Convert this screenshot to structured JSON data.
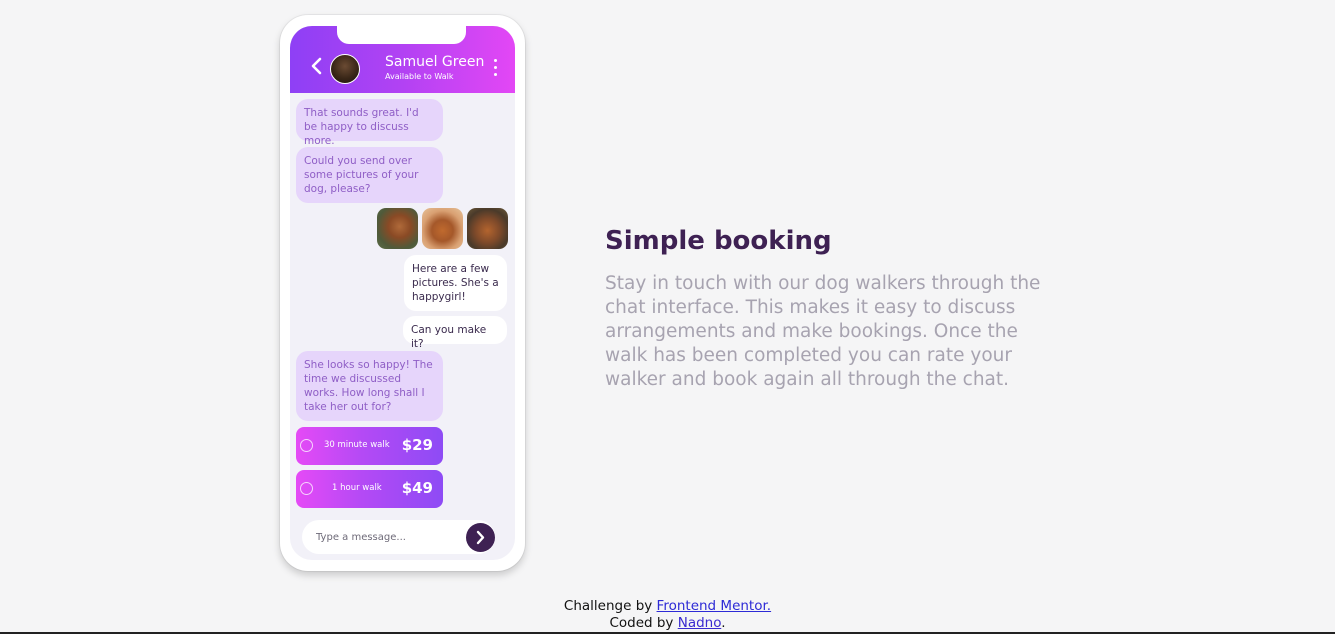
{
  "chat": {
    "contact_name": "Samuel Green",
    "contact_status": "Available to Walk",
    "messages": [
      "That sounds great. I'd be happy to discuss more.",
      "Could you send over some pictures of your dog, please?",
      "Here are a few pictures. She's a happygirl!",
      "Can you make it?",
      "She looks so happy! The time we discussed works. How long shall I take her out for?"
    ],
    "options": [
      {
        "label": "30 minute walk",
        "price": "$29"
      },
      {
        "label": "1 hour walk",
        "price": "$49"
      }
    ],
    "input_placeholder": "Type a message..."
  },
  "feature": {
    "title": "Simple booking",
    "description": "Stay in touch with our dog walkers through the chat interface. This makes it easy to discuss arrangements and make bookings. Once the walk has been completed you can rate your walker and book again all through the chat."
  },
  "footer": {
    "challenge_prefix": "Challenge by ",
    "challenge_link": "Frontend Mentor.",
    "coded_prefix": "Coded by ",
    "coded_link": "Nadno",
    "coded_suffix": "."
  },
  "colors": {
    "accent_dark": "#3e2153",
    "gradient_start": "#8e40f5",
    "gradient_end": "#e347f5",
    "incoming_bubble": "#e6d5fb",
    "incoming_text": "#8f5ec6",
    "body_text": "#a7a3b0"
  },
  "icons": [
    "back-icon",
    "avatar",
    "menu-dots-icon",
    "dog-photo",
    "radio-icon",
    "send-icon"
  ]
}
